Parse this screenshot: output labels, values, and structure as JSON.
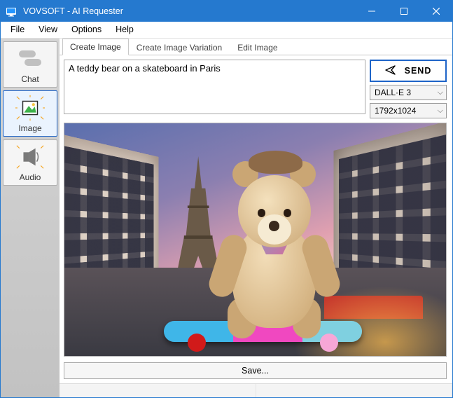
{
  "window": {
    "title": "VOVSOFT - AI Requester"
  },
  "menu": {
    "file": "File",
    "view": "View",
    "options": "Options",
    "help": "Help"
  },
  "sidebar": {
    "chat": {
      "label": "Chat"
    },
    "image": {
      "label": "Image"
    },
    "audio": {
      "label": "Audio"
    }
  },
  "tabs": {
    "create": {
      "label": "Create Image"
    },
    "variation": {
      "label": "Create Image Variation"
    },
    "edit": {
      "label": "Edit Image"
    }
  },
  "prompt": {
    "value": "A teddy bear on a skateboard in Paris"
  },
  "controls": {
    "send": {
      "label": "SEND"
    },
    "model": {
      "value": "DALL·E 3"
    },
    "size": {
      "value": "1792x1024"
    }
  },
  "save": {
    "label": "Save..."
  }
}
